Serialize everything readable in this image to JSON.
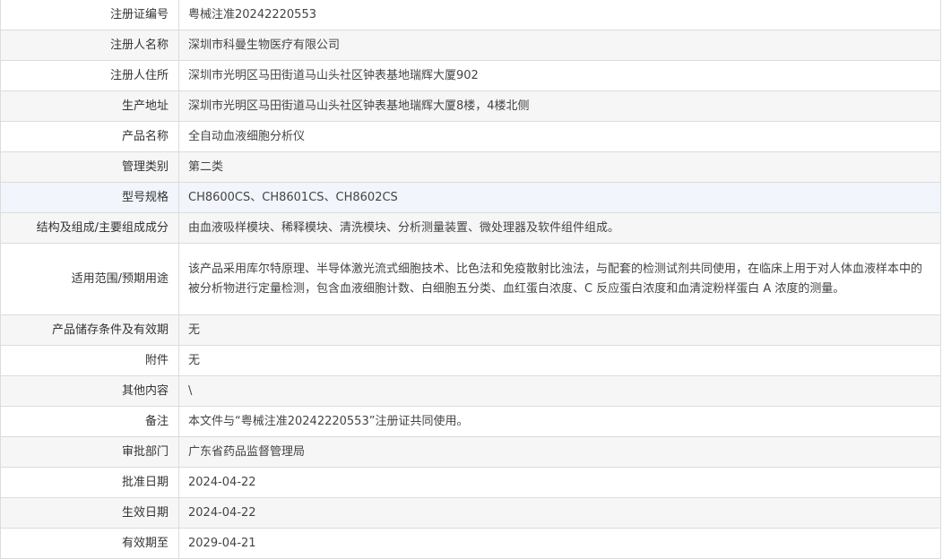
{
  "rows": [
    {
      "label": "注册证编号",
      "value": "粤械注准20242220553"
    },
    {
      "label": "注册人名称",
      "value": "深圳市科曼生物医疗有限公司"
    },
    {
      "label": "注册人住所",
      "value": "深圳市光明区马田街道马山头社区钟表基地瑞辉大厦902"
    },
    {
      "label": "生产地址",
      "value": "深圳市光明区马田街道马山头社区钟表基地瑞辉大厦8楼，4楼北侧"
    },
    {
      "label": "产品名称",
      "value": "全自动血液细胞分析仪"
    },
    {
      "label": "管理类别",
      "value": "第二类"
    },
    {
      "label": "型号规格",
      "value": "CH8600CS、CH8601CS、CH8602CS"
    },
    {
      "label": "结构及组成/主要组成成分",
      "value": "由血液吸样模块、稀释模块、清洗模块、分析测量装置、微处理器及软件组件组成。"
    },
    {
      "label": "适用范围/预期用途",
      "value": "该产品采用库尔特原理、半导体激光流式细胞技术、比色法和免疫散射比浊法，与配套的检测试剂共同使用，在临床上用于对人体血液样本中的被分析物进行定量检测，包含血液细胞计数、白细胞五分类、血红蛋白浓度、C 反应蛋白浓度和血清淀粉样蛋白 A 浓度的测量。"
    },
    {
      "label": "产品储存条件及有效期",
      "value": "无"
    },
    {
      "label": "附件",
      "value": "无"
    },
    {
      "label": "其他内容",
      "value": "\\"
    },
    {
      "label": "备注",
      "value": "本文件与“粤械注准20242220553”注册证共同使用。"
    },
    {
      "label": "审批部门",
      "value": "广东省药品监督管理局"
    },
    {
      "label": "批准日期",
      "value": "2024-04-22"
    },
    {
      "label": "生效日期",
      "value": "2024-04-22"
    },
    {
      "label": "有效期至",
      "value": "2029-04-21"
    }
  ]
}
